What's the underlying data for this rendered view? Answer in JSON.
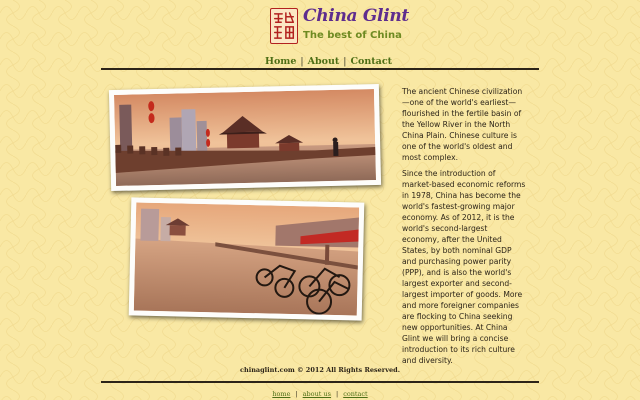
{
  "site": {
    "title": "China Glint",
    "tagline": "The best of China"
  },
  "nav": {
    "items": [
      "Home",
      "About",
      "Contact"
    ],
    "separator": "|"
  },
  "content": {
    "paragraphs": [
      "The ancient Chinese civilization—one of the world's earliest—flourished in the fertile basin of the Yellow River in the North China Plain. Chinese culture is one of the world's oldest and most complex.",
      "Since the introduction of market-based economic reforms in 1978, China has become the world's fastest-growing major economy. As of 2012, it is the world's second-largest economy, after the United States, by both nominal GDP and purchasing power parity (PPP), and is also the world's largest exporter and second-largest importer of goods. More and more foreigner companies are flocking to China seeking new opportunities. At China Glint we will bring a concise introduction to its rich culture and diversity."
    ]
  },
  "footer": {
    "copyright": "chinaglint.com © 2012 All Rights Reserved.",
    "links": [
      "home",
      "about us",
      "contact"
    ],
    "separator": "|"
  },
  "icons": {
    "logo": "chinese-seal-logo",
    "photo1": "city-wall-photo",
    "photo2": "bicycles-on-wall-photo"
  },
  "colors": {
    "background": "#f9e8a4",
    "title": "#5e2d8e",
    "tagline": "#6e8a22",
    "nav_link": "#4d6e16",
    "rule": "#2c2418",
    "seal_red": "#b2221f"
  }
}
